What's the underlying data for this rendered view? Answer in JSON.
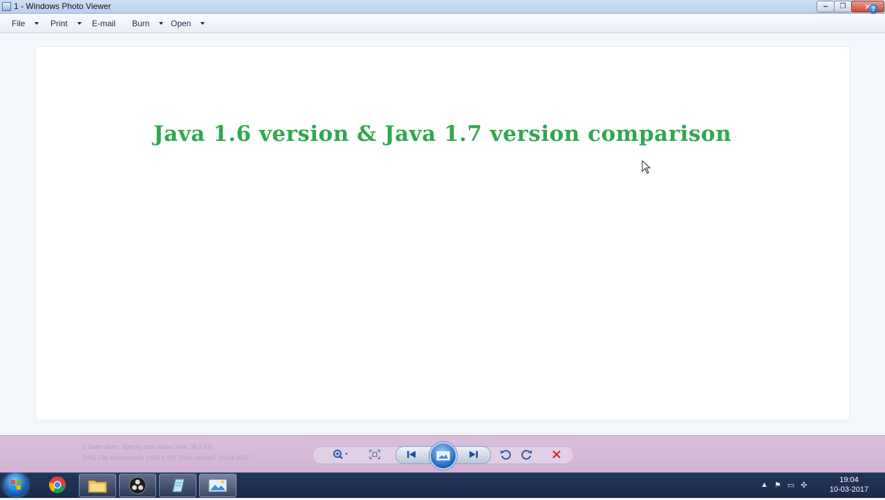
{
  "window": {
    "title": "1 - Windows Photo Viewer"
  },
  "menu": {
    "file": "File",
    "print": "Print",
    "email": "E-mail",
    "burn": "Burn",
    "open": "Open"
  },
  "photo": {
    "heading": "Java 1.6 version &  Java 1.7 version comparison"
  },
  "status": {
    "line1": "1      Date taken: Specify date taken          Size: 36.6 KB",
    "line2": "PNG File   Dimensions: 1280 x 707              Date created: 10-03-2017"
  },
  "controls": [
    "zoom-icon",
    "actual-size-icon",
    "previous-icon",
    "play-slideshow-icon",
    "next-icon",
    "rotate-left-icon",
    "rotate-right-icon",
    "delete-icon"
  ],
  "taskbar": {
    "apps": [
      "chrome-icon",
      "file-explorer-icon",
      "obs-icon",
      "notepad-icon",
      "photo-viewer-icon"
    ],
    "time": "19:04",
    "date": "10-03-2017"
  },
  "colors": {
    "heading": "#2fa84f",
    "delete": "#d42a2a",
    "taskbar": "#1a2a4a"
  }
}
